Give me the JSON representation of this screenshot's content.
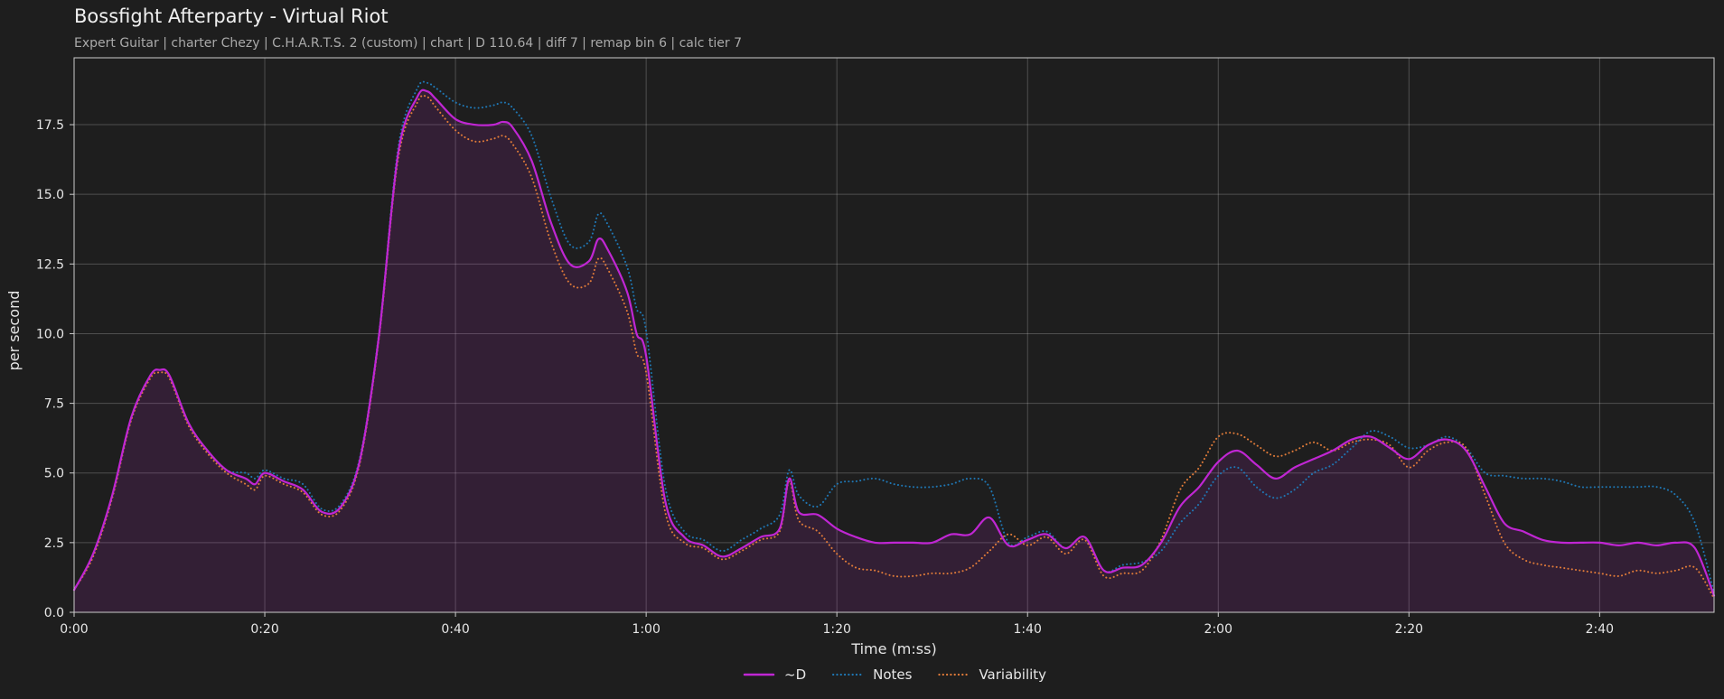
{
  "chart_data": {
    "type": "line",
    "title": "Bossfight Afterparty - Virtual Riot",
    "subtitle": "Expert Guitar  |  charter Chezy  |  C.H.A.R.T.S. 2 (custom)  |  chart  |  D 110.64  |  diff 7  |  remap bin 6  |  calc tier 7",
    "xlabel": "Time (m:ss)",
    "ylabel": "per second",
    "xlim": [
      0,
      172
    ],
    "ylim": [
      0,
      19.9
    ],
    "x_ticks": [
      0,
      20,
      40,
      60,
      80,
      100,
      120,
      140,
      160
    ],
    "x_tick_labels": [
      "0:00",
      "0:20",
      "0:40",
      "1:00",
      "1:20",
      "1:40",
      "2:00",
      "2:20",
      "2:40"
    ],
    "y_ticks": [
      0,
      2.5,
      5,
      7.5,
      10,
      12.5,
      15,
      17.5
    ],
    "y_tick_labels": [
      "0.0",
      "2.5",
      "5.0",
      "7.5",
      "10.0",
      "12.5",
      "15.0",
      "17.5"
    ],
    "grid": true,
    "legend_position": "bottom-center",
    "x": [
      0,
      2,
      4,
      6,
      8,
      9,
      10,
      12,
      14,
      16,
      18,
      19,
      20,
      22,
      24,
      26,
      28,
      30,
      32,
      34,
      36,
      37,
      38,
      40,
      42,
      44,
      45,
      46,
      48,
      50,
      52,
      54,
      55,
      56,
      58,
      59,
      60,
      62,
      64,
      66,
      68,
      70,
      72,
      74,
      75,
      76,
      78,
      80,
      82,
      84,
      86,
      88,
      90,
      92,
      94,
      96,
      98,
      100,
      102,
      104,
      106,
      108,
      110,
      112,
      114,
      116,
      118,
      120,
      122,
      124,
      126,
      128,
      130,
      132,
      134,
      136,
      138,
      140,
      142,
      144,
      146,
      148,
      150,
      152,
      154,
      156,
      158,
      160,
      162,
      164,
      166,
      168,
      170,
      172
    ],
    "series": [
      {
        "name": "~D",
        "color": "#c026d3",
        "style": "solid",
        "fill": true,
        "values": [
          0.8,
          2.1,
          4.2,
          7.0,
          8.5,
          8.7,
          8.5,
          6.8,
          5.8,
          5.1,
          4.8,
          4.6,
          5.0,
          4.7,
          4.4,
          3.6,
          3.8,
          5.5,
          10.0,
          16.5,
          18.5,
          18.7,
          18.4,
          17.7,
          17.5,
          17.5,
          17.6,
          17.4,
          16.2,
          14.0,
          12.5,
          12.6,
          13.4,
          13.0,
          11.5,
          10.0,
          9.2,
          4.0,
          2.7,
          2.4,
          2.0,
          2.3,
          2.7,
          3.0,
          4.8,
          3.6,
          3.5,
          3.0,
          2.7,
          2.5,
          2.5,
          2.5,
          2.5,
          2.8,
          2.8,
          3.4,
          2.4,
          2.6,
          2.8,
          2.3,
          2.7,
          1.5,
          1.6,
          1.7,
          2.5,
          3.8,
          4.5,
          5.4,
          5.8,
          5.3,
          4.8,
          5.2,
          5.5,
          5.8,
          6.2,
          6.3,
          5.9,
          5.5,
          6.0,
          6.2,
          5.8,
          4.5,
          3.2,
          2.9,
          2.6,
          2.5,
          2.5,
          2.5,
          2.4,
          2.5,
          2.4,
          2.5,
          2.3,
          0.6
        ]
      },
      {
        "name": "Notes",
        "color": "#1f77b4",
        "style": "dotted",
        "fill": false,
        "values": [
          0.8,
          2.1,
          4.2,
          7.0,
          8.5,
          8.7,
          8.5,
          6.8,
          5.8,
          5.1,
          5.0,
          4.8,
          5.1,
          4.8,
          4.6,
          3.7,
          3.9,
          5.6,
          10.1,
          16.7,
          18.8,
          19.0,
          18.8,
          18.3,
          18.1,
          18.2,
          18.3,
          18.1,
          17.1,
          14.9,
          13.2,
          13.3,
          14.3,
          13.9,
          12.4,
          10.9,
          10.1,
          4.5,
          2.9,
          2.6,
          2.2,
          2.6,
          3.0,
          3.5,
          5.1,
          4.2,
          3.8,
          4.6,
          4.7,
          4.8,
          4.6,
          4.5,
          4.5,
          4.6,
          4.8,
          4.5,
          2.5,
          2.7,
          2.9,
          2.3,
          2.7,
          1.5,
          1.7,
          1.8,
          2.2,
          3.2,
          3.9,
          4.9,
          5.2,
          4.5,
          4.1,
          4.4,
          5.0,
          5.3,
          5.9,
          6.5,
          6.3,
          5.9,
          6.0,
          6.3,
          5.9,
          5.0,
          4.9,
          4.8,
          4.8,
          4.7,
          4.5,
          4.5,
          4.5,
          4.5,
          4.5,
          4.2,
          3.2,
          0.7
        ]
      },
      {
        "name": "Variability",
        "color": "#e07b39",
        "style": "dotted",
        "fill": false,
        "values": [
          0.8,
          2.0,
          4.1,
          6.9,
          8.4,
          8.6,
          8.4,
          6.7,
          5.7,
          5.0,
          4.6,
          4.4,
          4.9,
          4.6,
          4.3,
          3.5,
          3.7,
          5.4,
          9.9,
          16.3,
          18.3,
          18.5,
          18.1,
          17.3,
          16.9,
          17.0,
          17.1,
          16.8,
          15.6,
          13.3,
          11.8,
          11.8,
          12.7,
          12.3,
          10.8,
          9.3,
          8.6,
          3.6,
          2.5,
          2.3,
          1.9,
          2.2,
          2.6,
          2.9,
          4.7,
          3.3,
          2.9,
          2.1,
          1.6,
          1.5,
          1.3,
          1.3,
          1.4,
          1.4,
          1.6,
          2.2,
          2.8,
          2.4,
          2.7,
          2.1,
          2.6,
          1.3,
          1.4,
          1.5,
          2.6,
          4.4,
          5.2,
          6.3,
          6.4,
          6.0,
          5.6,
          5.8,
          6.1,
          5.8,
          6.1,
          6.2,
          6.0,
          5.2,
          5.8,
          6.1,
          5.9,
          4.2,
          2.5,
          1.9,
          1.7,
          1.6,
          1.5,
          1.4,
          1.3,
          1.5,
          1.4,
          1.5,
          1.6,
          0.5
        ]
      }
    ]
  }
}
